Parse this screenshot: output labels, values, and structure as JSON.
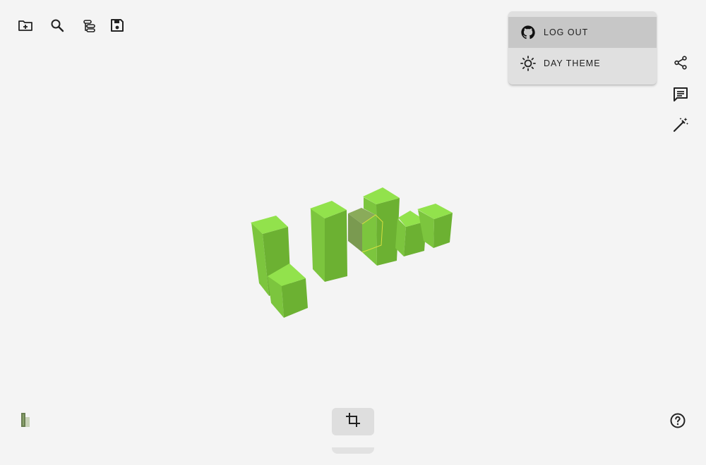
{
  "toolbar": {
    "icons": [
      "folder-plus-icon",
      "search-icon",
      "layers-icon",
      "save-icon"
    ]
  },
  "account_menu": {
    "items": [
      {
        "label": "LOG OUT",
        "icon": "github-icon",
        "active": true
      },
      {
        "label": "DAY THEME",
        "icon": "sun-icon",
        "active": false
      }
    ]
  },
  "side_actions": {
    "icons": [
      "share-icon",
      "comment-icon",
      "magic-wand-icon"
    ]
  },
  "bottom": {
    "crop_icon": "crop-icon",
    "help_icon": "help-icon",
    "logo_icon": "building-logo-icon"
  },
  "colors": {
    "background": "#f4f4f4",
    "block_top": "#8ee04a",
    "block_left": "#78c63a",
    "block_right": "#6aaf30",
    "selected_block": "#7a9a50",
    "selection_outline": "#d8e040",
    "menu_bg": "#e0e0e0",
    "menu_active": "#c7c7c7"
  }
}
